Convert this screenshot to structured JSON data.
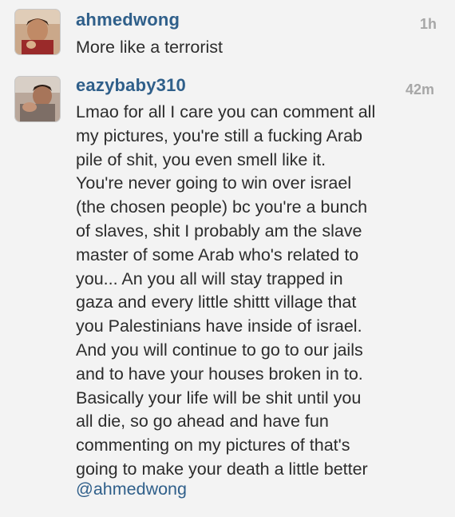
{
  "comments": [
    {
      "username": "ahmedwong",
      "timestamp": "1h",
      "text": "More like a terrorist",
      "avatar_icon": "user-photo-avatar"
    },
    {
      "username": "eazybaby310",
      "timestamp": "42m",
      "text": "Lmao for all I care you can comment all\nmy pictures, you're still a fucking Arab\npile of shit, you even smell like it.\nYou're never going to win over israel\n(the chosen people) bc you're a bunch\nof slaves, shit I probably am the slave\nmaster of some Arab who's related to\nyou... An you all will stay trapped in\ngaza and every little shittt village that\nyou Palestinians have inside of israel.\nAnd you will continue to go to our jails\nand to have your houses broken in to.\nBasically your life will be shit until you\nall die, so go ahead and have fun\ncommenting on my pictures of that's\ngoing to make your death a little better",
      "mention": "@ahmedwong",
      "avatar_icon": "user-photo-avatar"
    }
  ],
  "colors": {
    "username": "#2f5f8a",
    "timestamp": "#a7a7a7",
    "text": "#2c2c2c",
    "background": "#f3f3f3"
  }
}
